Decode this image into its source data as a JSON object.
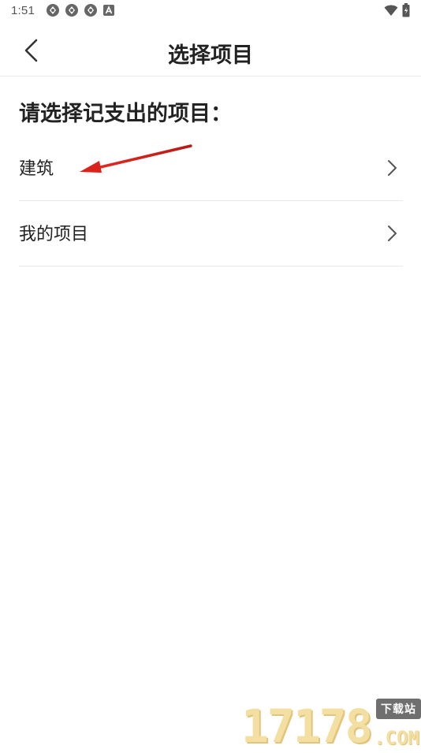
{
  "status_bar": {
    "time": "1:51",
    "left_icons": [
      "sync-icon",
      "sync-icon",
      "sync-icon",
      "font-a-icon"
    ],
    "right_icons": [
      "wifi-icon",
      "battery-icon"
    ]
  },
  "app_bar": {
    "back_icon": "chevron-left-icon",
    "title": "选择项目"
  },
  "prompt": "请选择记支出的项目：",
  "items": [
    {
      "label": "建筑",
      "icon": "chevron-right-icon"
    },
    {
      "label": "我的项目",
      "icon": "chevron-right-icon"
    }
  ],
  "annotation": {
    "type": "arrow",
    "color": "#d9231b",
    "points_to": "建筑"
  },
  "watermark": {
    "digits": "17178",
    "badge": "下载站",
    "domain": ".COM"
  },
  "colors": {
    "background": "#ffffff",
    "text": "#222222",
    "divider": "#e8e8e8",
    "annotation_red": "#d9231b"
  }
}
